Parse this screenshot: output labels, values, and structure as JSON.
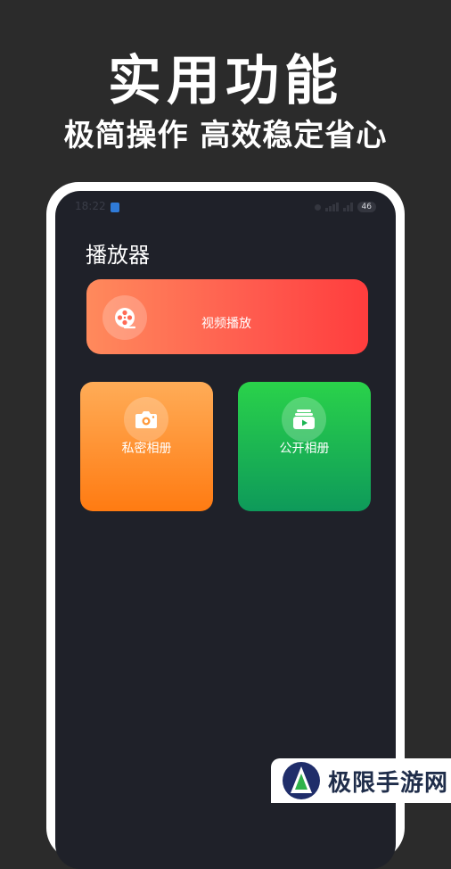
{
  "promo": {
    "headline": "实用功能",
    "subheadline": "极简操作 高效稳定省心"
  },
  "status_bar": {
    "time": "18:22",
    "network_badge": "46"
  },
  "app": {
    "title": "播放器",
    "cards": {
      "video": {
        "label": "视频播放",
        "icon": "film-reel-icon"
      },
      "private_album": {
        "label": "私密相册",
        "icon": "camera-icon"
      },
      "public_album": {
        "label": "公开相册",
        "icon": "video-album-icon"
      }
    }
  },
  "watermark": {
    "text": "极限手游网"
  },
  "colors": {
    "background": "#2b2b2b",
    "phone_screen": "#1f2129",
    "video_card": "#ff5a4e",
    "private_card": "#ff8a1c",
    "public_card": "#1cc04f"
  }
}
